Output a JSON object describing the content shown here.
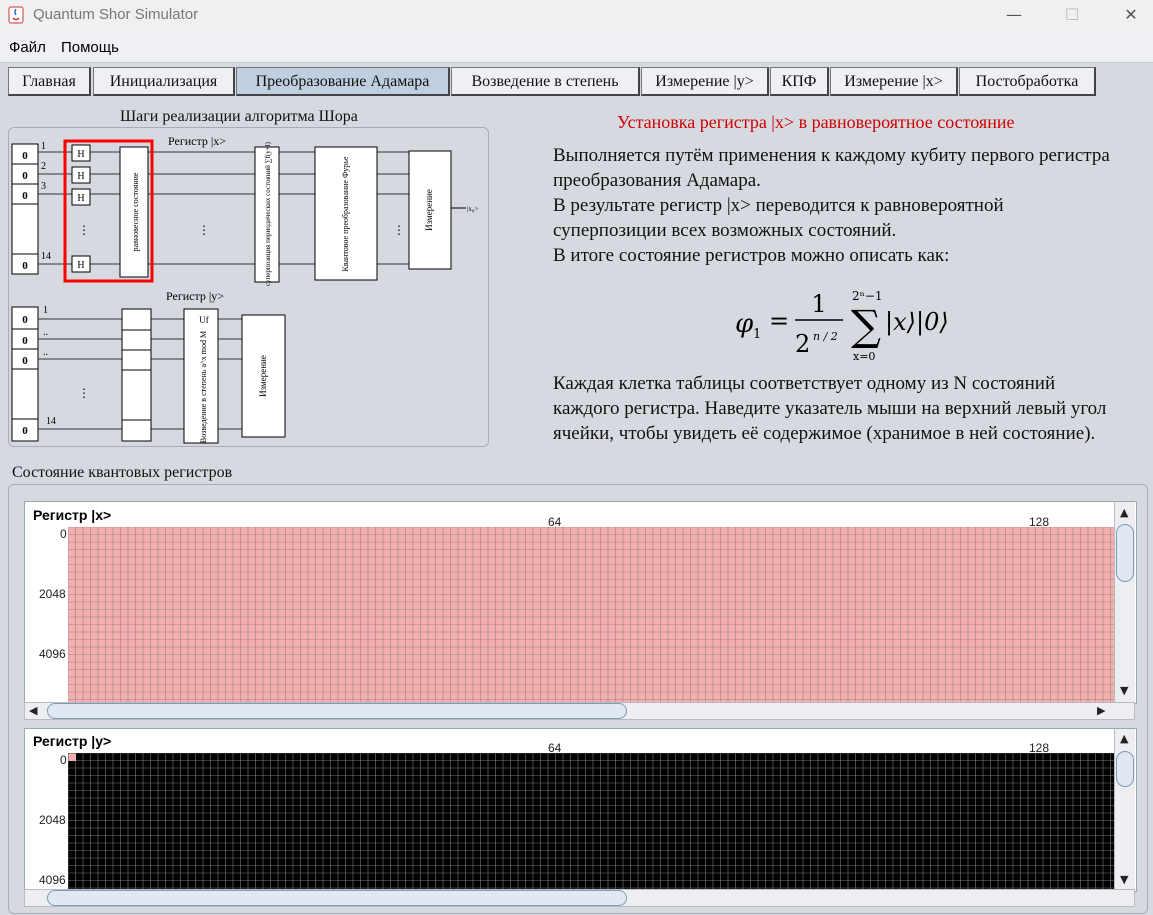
{
  "window": {
    "title": "Quantum Shor Simulator"
  },
  "menu": {
    "items": [
      "Файл",
      "Помощь"
    ]
  },
  "tabs": [
    {
      "label": "Главная",
      "active": false
    },
    {
      "label": "Инициализация",
      "active": false
    },
    {
      "label": "Преобразование Адамара",
      "active": true
    },
    {
      "label": "Возведение в степень",
      "active": false
    },
    {
      "label": "Измерение |y>",
      "active": false
    },
    {
      "label": "КПФ",
      "active": false
    },
    {
      "label": "Измерение |x>",
      "active": false
    },
    {
      "label": "Постобработка",
      "active": false
    }
  ],
  "diagram": {
    "title": "Шаги реализации алгоритма Шора",
    "reg_x_label": "Регистр |x>",
    "reg_y_label": "Регистр |y>",
    "cell_value": "0",
    "qubit_labels_x": [
      "1",
      "2",
      "3",
      "14"
    ],
    "qubit_labels_y": [
      "1",
      "..",
      "..",
      "14"
    ],
    "hadamard_gate": "H",
    "dots": "⋮",
    "block_equal_superposition": "равновесное состояние",
    "block_periodic": "суперпозиция периодических состояний ∑f(y+l)",
    "block_qft": "Квантовое преобразование Фурье",
    "block_measure": "Измерение",
    "block_exp": "Возведение в степень a^x mod M",
    "uf_label": "Uf",
    "output_label": "|x₀>"
  },
  "info": {
    "title": "Установка регистра |x> в равновероятное состояние",
    "paragraph1": "Выполняется путём применения к каждому кубиту первого регистра преобразования Адамара.",
    "paragraph2": "В результате регистр |x> переводится к равновероятной суперпозиции всех возможных состояний.",
    "paragraph3": "В итоге состояние регистров можно описать как:",
    "formula": {
      "lhs": "φ",
      "lhs_sub": "1",
      "eq": "=",
      "num": "1",
      "den_base": "2",
      "den_exp": "n / 2",
      "sum_sup": "2ⁿ−1",
      "sum_sub": "x=0",
      "term": "|x⟩|0⟩"
    },
    "paragraph4": "Каждая клетка таблицы соответствует одному из N состояний каждого регистра. Наведите указатель мыши на верхний левый угол ячейки, чтобы увидеть её содержимое (хранимое в ней состояние)."
  },
  "registers": {
    "section_title": "Состояние квантовых регистров",
    "x": {
      "title": "Регистр |x>",
      "col_labels": [
        "64",
        "128"
      ],
      "row_labels": [
        "0",
        "2048",
        "4096"
      ],
      "fill_color": "#f4b0b0",
      "line_color": "#a08080"
    },
    "y": {
      "title": "Регистр |y>",
      "col_labels": [
        "64",
        "128"
      ],
      "row_labels": [
        "0",
        "2048",
        "4096"
      ],
      "fill_color": "#000000",
      "line_color": "#7a7a7a",
      "highlight_color": "#f4b0b0"
    }
  },
  "colors": {
    "accent_red": "#d00000",
    "selection_box": "#ff0000"
  }
}
